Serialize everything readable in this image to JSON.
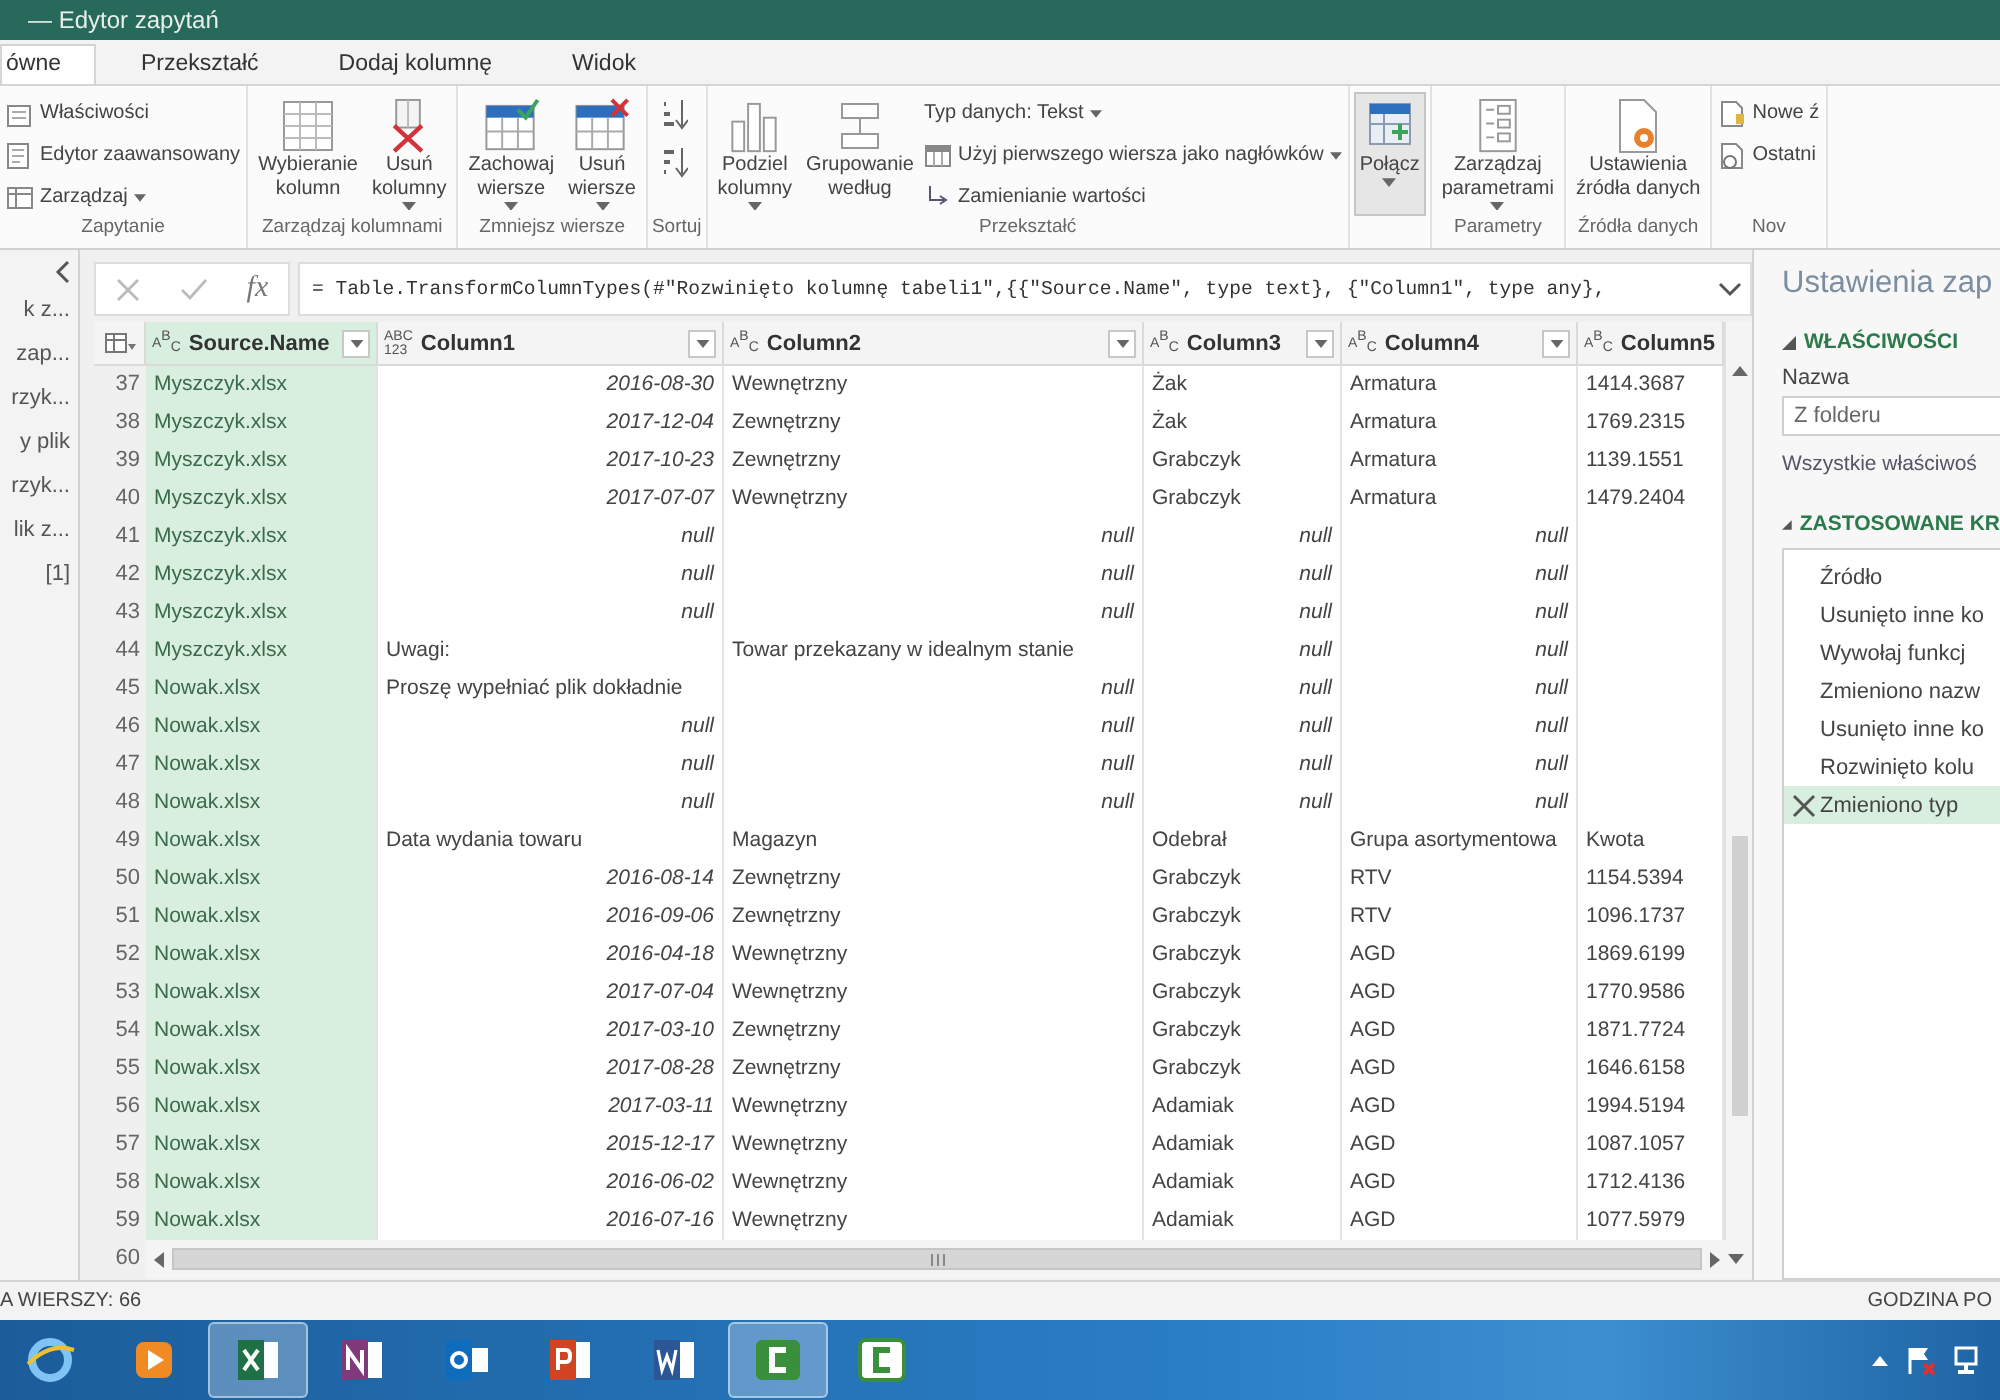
{
  "window": {
    "title": "— Edytor zapytań"
  },
  "tabs": [
    {
      "label": "ówne",
      "selected": true
    },
    {
      "label": "Przekształć",
      "selected": false
    },
    {
      "label": "Dodaj kolumnę",
      "selected": false
    },
    {
      "label": "Widok",
      "selected": false
    }
  ],
  "ribbon": {
    "groups": [
      {
        "label": "Zapytanie",
        "items": [
          {
            "kind": "small",
            "label": "Właściwości"
          },
          {
            "kind": "small",
            "label": "Edytor zaawansowany"
          },
          {
            "kind": "small",
            "label": "Zarządzaj",
            "dropdown": true
          }
        ]
      },
      {
        "label": "Zarządzaj kolumnami",
        "items": [
          {
            "kind": "large",
            "lines": [
              "Wybieranie",
              "kolumn"
            ]
          },
          {
            "kind": "large",
            "lines": [
              "Usuń",
              "kolumny"
            ],
            "dropdown": true
          }
        ]
      },
      {
        "label": "Zmniejsz wiersze",
        "items": [
          {
            "kind": "large",
            "lines": [
              "Zachowaj",
              "wiersze"
            ],
            "dropdown": true
          },
          {
            "kind": "large",
            "lines": [
              "Usuń",
              "wiersze"
            ],
            "dropdown": true
          }
        ]
      },
      {
        "label": "Sortuj",
        "items": [
          {
            "kind": "sort"
          },
          {
            "kind": "sort"
          }
        ]
      },
      {
        "label": "Przekształć",
        "items": [
          {
            "kind": "large",
            "lines": [
              "Podziel",
              "kolumny"
            ],
            "dropdown": true
          },
          {
            "kind": "large",
            "lines": [
              "Grupowanie",
              "według"
            ]
          },
          {
            "kind": "small",
            "label": "Typ danych: Tekst",
            "dropdown": true
          },
          {
            "kind": "small",
            "label": "Użyj pierwszego wiersza jako nagłówków",
            "dropdown": true
          },
          {
            "kind": "small",
            "label": "Zamienianie wartości"
          }
        ]
      },
      {
        "items": [
          {
            "kind": "large",
            "lines": [
              "Połącz"
            ],
            "dropdown": true,
            "pressed": true
          }
        ]
      },
      {
        "label": "Parametry",
        "items": [
          {
            "kind": "large",
            "lines": [
              "Zarządzaj",
              "parametrami"
            ],
            "dropdown": true
          }
        ]
      },
      {
        "label": "Źródła danych",
        "items": [
          {
            "kind": "large",
            "lines": [
              "Ustawienia",
              "źródła danych"
            ]
          }
        ]
      },
      {
        "label": "Nov",
        "items": [
          {
            "kind": "small",
            "label": "Nowe ź"
          },
          {
            "kind": "small",
            "label": "Ostatni"
          }
        ]
      }
    ]
  },
  "queries": [
    "k z...",
    "zap...",
    "rzyk...",
    "y plik",
    "rzyk...",
    "lik z...",
    "[1]"
  ],
  "formula_bar": {
    "fx": "fx",
    "formula": "= Table.TransformColumnTypes(#\"Rozwinięto kolumnę tabeli1\",{{\"Source.Name\", type text}, {\"Column1\", type any},"
  },
  "table": {
    "columns": [
      {
        "name": "Source.Name",
        "type_badge": [
          "A$^{B}$$_{C}$"
        ],
        "selected": true
      },
      {
        "name": "Column1",
        "type_badge": [
          "ABC",
          "123"
        ],
        "selected": false
      },
      {
        "name": "Column2",
        "type_badge": [
          "A$^{B}$$_{C}$"
        ],
        "selected": false
      },
      {
        "name": "Column3",
        "type_badge": [
          "A$^{B}$$_{C}$"
        ],
        "selected": false
      },
      {
        "name": "Column4",
        "type_badge": [
          "A$^{B}$$_{C}$"
        ],
        "selected": false
      },
      {
        "name": "Column5",
        "type_badge": [
          "A$^{B}$$_{C}$"
        ],
        "selected": false,
        "filter_button": false
      }
    ],
    "rows": [
      {
        "n": "37",
        "cells": [
          "Myszczyk.xlsx",
          {
            "text": "2016-08-30",
            "kind": "value"
          },
          "Wewnętrzny",
          "Żak",
          "Armatura",
          "1414.3687"
        ]
      },
      {
        "n": "38",
        "cells": [
          "Myszczyk.xlsx",
          {
            "text": "2017-12-04",
            "kind": "value"
          },
          "Zewnętrzny",
          "Żak",
          "Armatura",
          "1769.2315"
        ]
      },
      {
        "n": "39",
        "cells": [
          "Myszczyk.xlsx",
          {
            "text": "2017-10-23",
            "kind": "value"
          },
          "Zewnętrzny",
          "Grabczyk",
          "Armatura",
          "1139.1551"
        ]
      },
      {
        "n": "40",
        "cells": [
          "Myszczyk.xlsx",
          {
            "text": "2017-07-07",
            "kind": "value"
          },
          "Wewnętrzny",
          "Grabczyk",
          "Armatura",
          "1479.2404"
        ]
      },
      {
        "n": "41",
        "cells": [
          "Myszczyk.xlsx",
          {
            "text": "null",
            "kind": "value"
          },
          {
            "text": "null",
            "kind": "value"
          },
          {
            "text": "null",
            "kind": "value"
          },
          {
            "text": "null",
            "kind": "value"
          },
          null
        ]
      },
      {
        "n": "42",
        "cells": [
          "Myszczyk.xlsx",
          {
            "text": "null",
            "kind": "value"
          },
          {
            "text": "null",
            "kind": "value"
          },
          {
            "text": "null",
            "kind": "value"
          },
          {
            "text": "null",
            "kind": "value"
          },
          null
        ]
      },
      {
        "n": "43",
        "cells": [
          "Myszczyk.xlsx",
          {
            "text": "null",
            "kind": "value"
          },
          {
            "text": "null",
            "kind": "value"
          },
          {
            "text": "null",
            "kind": "value"
          },
          {
            "text": "null",
            "kind": "value"
          },
          null
        ]
      },
      {
        "n": "44",
        "cells": [
          "Myszczyk.xlsx",
          "Uwagi:",
          "Towar przekazany w idealnym stanie",
          {
            "text": "null",
            "kind": "value"
          },
          {
            "text": "null",
            "kind": "value"
          },
          null
        ]
      },
      {
        "n": "45",
        "cells": [
          "Nowak.xlsx",
          "Proszę wypełniać plik dokładnie",
          {
            "text": "null",
            "kind": "value"
          },
          {
            "text": "null",
            "kind": "value"
          },
          {
            "text": "null",
            "kind": "value"
          },
          null
        ]
      },
      {
        "n": "46",
        "cells": [
          "Nowak.xlsx",
          {
            "text": "null",
            "kind": "value"
          },
          {
            "text": "null",
            "kind": "value"
          },
          {
            "text": "null",
            "kind": "value"
          },
          {
            "text": "null",
            "kind": "value"
          },
          null
        ]
      },
      {
        "n": "47",
        "cells": [
          "Nowak.xlsx",
          {
            "text": "null",
            "kind": "value"
          },
          {
            "text": "null",
            "kind": "value"
          },
          {
            "text": "null",
            "kind": "value"
          },
          {
            "text": "null",
            "kind": "value"
          },
          null
        ]
      },
      {
        "n": "48",
        "cells": [
          "Nowak.xlsx",
          {
            "text": "null",
            "kind": "value"
          },
          {
            "text": "null",
            "kind": "value"
          },
          {
            "text": "null",
            "kind": "value"
          },
          {
            "text": "null",
            "kind": "value"
          },
          null
        ]
      },
      {
        "n": "49",
        "cells": [
          "Nowak.xlsx",
          "Data wydania towaru",
          "Magazyn",
          "Odebrał",
          "Grupa asortymentowa",
          "Kwota"
        ]
      },
      {
        "n": "50",
        "cells": [
          "Nowak.xlsx",
          {
            "text": "2016-08-14",
            "kind": "value"
          },
          "Zewnętrzny",
          "Grabczyk",
          "RTV",
          "1154.5394"
        ]
      },
      {
        "n": "51",
        "cells": [
          "Nowak.xlsx",
          {
            "text": "2016-09-06",
            "kind": "value"
          },
          "Zewnętrzny",
          "Grabczyk",
          "RTV",
          "1096.1737"
        ]
      },
      {
        "n": "52",
        "cells": [
          "Nowak.xlsx",
          {
            "text": "2016-04-18",
            "kind": "value"
          },
          "Wewnętrzny",
          "Grabczyk",
          "AGD",
          "1869.6199"
        ]
      },
      {
        "n": "53",
        "cells": [
          "Nowak.xlsx",
          {
            "text": "2017-07-04",
            "kind": "value"
          },
          "Wewnętrzny",
          "Grabczyk",
          "AGD",
          "1770.9586"
        ]
      },
      {
        "n": "54",
        "cells": [
          "Nowak.xlsx",
          {
            "text": "2017-03-10",
            "kind": "value"
          },
          "Zewnętrzny",
          "Grabczyk",
          "AGD",
          "1871.7724"
        ]
      },
      {
        "n": "55",
        "cells": [
          "Nowak.xlsx",
          {
            "text": "2017-08-28",
            "kind": "value"
          },
          "Zewnętrzny",
          "Grabczyk",
          "AGD",
          "1646.6158"
        ]
      },
      {
        "n": "56",
        "cells": [
          "Nowak.xlsx",
          {
            "text": "2017-03-11",
            "kind": "value"
          },
          "Wewnętrzny",
          "Adamiak",
          "AGD",
          "1994.5194"
        ]
      },
      {
        "n": "57",
        "cells": [
          "Nowak.xlsx",
          {
            "text": "2015-12-17",
            "kind": "value"
          },
          "Wewnętrzny",
          "Adamiak",
          "AGD",
          "1087.1057"
        ]
      },
      {
        "n": "58",
        "cells": [
          "Nowak.xlsx",
          {
            "text": "2016-06-02",
            "kind": "value"
          },
          "Wewnętrzny",
          "Adamiak",
          "AGD",
          "1712.4136"
        ]
      },
      {
        "n": "59",
        "cells": [
          "Nowak.xlsx",
          {
            "text": "2016-07-16",
            "kind": "value"
          },
          "Wewnętrzny",
          "Adamiak",
          "AGD",
          "1077.5979"
        ]
      }
    ],
    "last_row_number": "60"
  },
  "settings": {
    "title": "Ustawienia zap",
    "properties_heading": "WŁAŚCIWOŚCI",
    "name_label": "Nazwa",
    "name_value": "Z folderu",
    "all_properties_link": "Wszystkie właściwoś",
    "steps_heading": "ZASTOSOWANE KR",
    "steps": [
      {
        "label": "Źródło",
        "selected": false
      },
      {
        "label": "Usunięto inne ko",
        "selected": false
      },
      {
        "label": "Wywołaj funkcj",
        "selected": false
      },
      {
        "label": "Zmieniono nazw",
        "selected": false
      },
      {
        "label": "Usunięto inne ko",
        "selected": false
      },
      {
        "label": "Rozwinięto kolu",
        "selected": false
      },
      {
        "label": "Zmieniono typ",
        "selected": true
      }
    ]
  },
  "status_bar": {
    "left": "A WIERSZY: 66",
    "right": "GODZINA PO"
  },
  "taskbar": {
    "apps": [
      {
        "active": false
      },
      {
        "active": false
      },
      {
        "active": true
      },
      {
        "active": false
      },
      {
        "active": false
      },
      {
        "active": false
      },
      {
        "active": false
      },
      {
        "active": true
      },
      {
        "active": false
      }
    ]
  }
}
